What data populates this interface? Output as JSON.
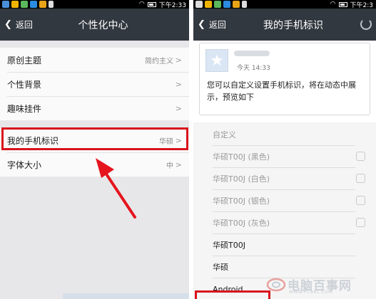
{
  "left": {
    "status": {
      "time": "下午2:33"
    },
    "header": {
      "back_label": "返回",
      "title": "个性化中心"
    },
    "group1": [
      {
        "label": "原创主题",
        "value": "简约主义"
      },
      {
        "label": "个性背景",
        "value": ""
      },
      {
        "label": "趣味挂件",
        "value": ""
      }
    ],
    "group2": [
      {
        "label": "我的手机标识",
        "value": "华硕"
      },
      {
        "label": "字体大小",
        "value": "中"
      }
    ]
  },
  "right": {
    "status": {
      "time": "下午2:3"
    },
    "header": {
      "back_label": "返回",
      "title": "我的手机标识"
    },
    "card": {
      "time": "今天 14:33",
      "text": "您可以自定义设置手机标识，将在动态中展示，预览如下"
    },
    "options": [
      {
        "label": "自定义",
        "enabled": false
      },
      {
        "label": "华硕T00J (黑色)",
        "enabled": false
      },
      {
        "label": "华硕T00J (白色)",
        "enabled": false
      },
      {
        "label": "华硕T00J (银色)",
        "enabled": false
      },
      {
        "label": "华硕T00J (灰色)",
        "enabled": false
      },
      {
        "label": "华硕T00J",
        "enabled": true
      },
      {
        "label": "华硕",
        "enabled": true
      },
      {
        "label": "Android",
        "enabled": true
      }
    ]
  },
  "watermark": {
    "brand": "电脑百事网",
    "url": "WWW.PC841.COM"
  },
  "colors": {
    "titlebar": "#32383f",
    "highlight": "#d9121c",
    "disabled_text": "#9a9a9a"
  }
}
